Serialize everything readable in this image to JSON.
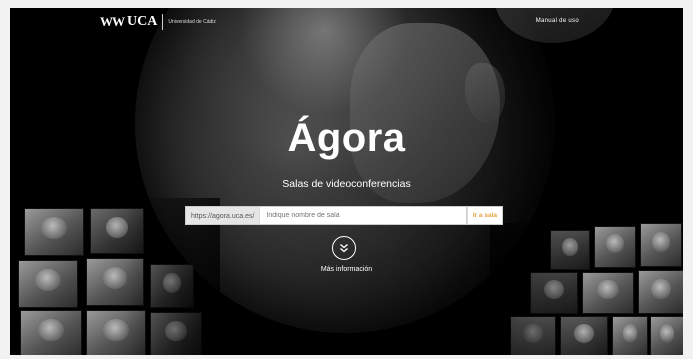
{
  "header": {
    "logo_text": "UCA",
    "logo_university": "Universidad de Cádiz",
    "manual_link": "Manual de uso"
  },
  "hero": {
    "title": "Ágora",
    "subtitle": "Salas de videoconferencias"
  },
  "search": {
    "prefix": "https://agora.uca.es/",
    "placeholder": "Indique nombre de sala",
    "button_label": "Ir a sala"
  },
  "more_info": {
    "label": "Más información",
    "icon": "double-chevron-down-icon"
  },
  "colors": {
    "background": "#000000",
    "accent": "#e8a23c",
    "text": "#ffffff"
  }
}
